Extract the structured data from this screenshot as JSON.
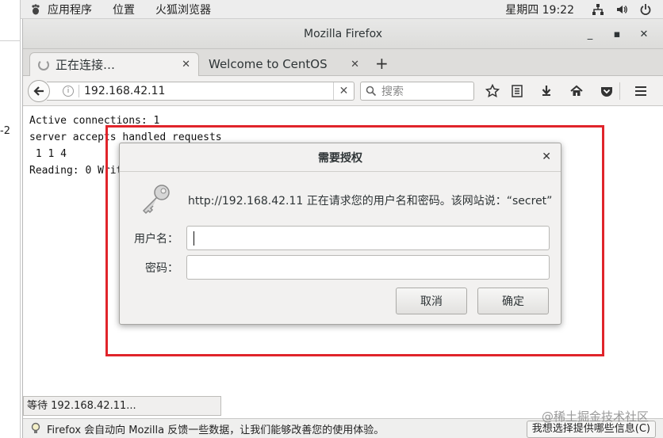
{
  "left_slice": {
    "fragment": "-2"
  },
  "topbar": {
    "menus": [
      "应用程序",
      "位置",
      "火狐浏览器"
    ],
    "clock": "星期四 19:22"
  },
  "window": {
    "title": "Mozilla Firefox",
    "controls": {
      "minimize": "_",
      "maximize": "▪",
      "close": "✕"
    }
  },
  "tabs": [
    {
      "label": "正在连接…",
      "close": "✕"
    },
    {
      "label": "Welcome to CentOS",
      "close": "✕"
    }
  ],
  "new_tab": "+",
  "navbar": {
    "url": "192.168.42.11",
    "clear": "✕",
    "search_placeholder": "搜索"
  },
  "content": {
    "lines": [
      "Active connections: 1",
      "server accepts handled requests",
      " 1 1 4",
      "Reading: 0 Writi"
    ]
  },
  "dialog": {
    "title": "需要授权",
    "close": "✕",
    "message": "http://192.168.42.11 正在请求您的用户名和密码。该网站说：“secret”",
    "username_label": "用户名：",
    "password_label": "密码：",
    "username_value": "",
    "password_value": "",
    "cancel_label": "取消",
    "ok_label": "确定"
  },
  "status": {
    "text": "等待 192.168.42.11..."
  },
  "notification": {
    "text": "Firefox 会自动向 Mozilla 反馈一些数据，让我们能够改善您的使用体验。",
    "button": "我想选择提供哪些信息(C)"
  },
  "watermark": "@稀土掘金技术社区",
  "colors": {
    "highlight": "#e0242b",
    "chrome": "#f2f1f0"
  }
}
